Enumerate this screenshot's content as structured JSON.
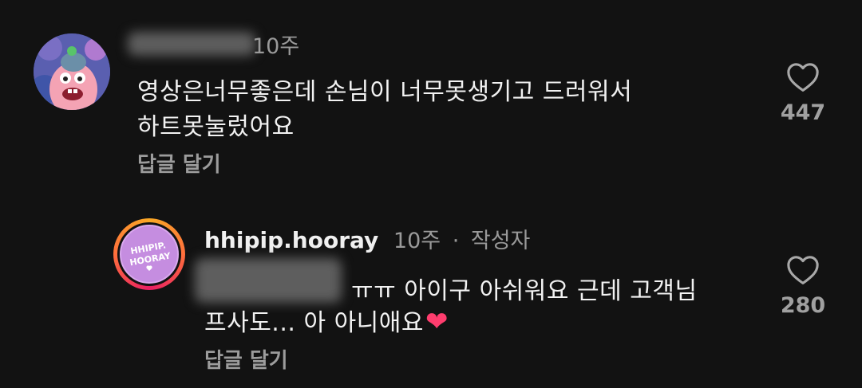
{
  "comments": [
    {
      "time": "10주",
      "lines": [
        "영상은너무좋은데 손님이 너무못생기고 드러워서",
        "하트못눌렀어요"
      ],
      "reply_label": "답글 달기",
      "likes": "447",
      "avatar_icon": "cartoon-avatar-icon"
    },
    {
      "username": "hhipip.hooray",
      "time": "10주",
      "separator": "·",
      "author_badge": "작성자",
      "lines": [
        "ㅠㅠ 아이구 아쉬워요 근데 고객님",
        "프사도... 아 아니애요"
      ],
      "emoji": "❤",
      "reply_label": "답글 달기",
      "likes": "280",
      "avatar_text": [
        "HHIPIP.",
        "HOORAY"
      ],
      "avatar_icon": "hhipip-hooray-logo-icon"
    }
  ],
  "colors": {
    "background": "#121212",
    "text": "#f2f2f2",
    "muted": "#9a9a9a",
    "story_ring_start": "#f9a825",
    "story_ring_end": "#e91e63",
    "logo_purple": "#c58de0",
    "heart_emoji": "#ff3d6e"
  }
}
